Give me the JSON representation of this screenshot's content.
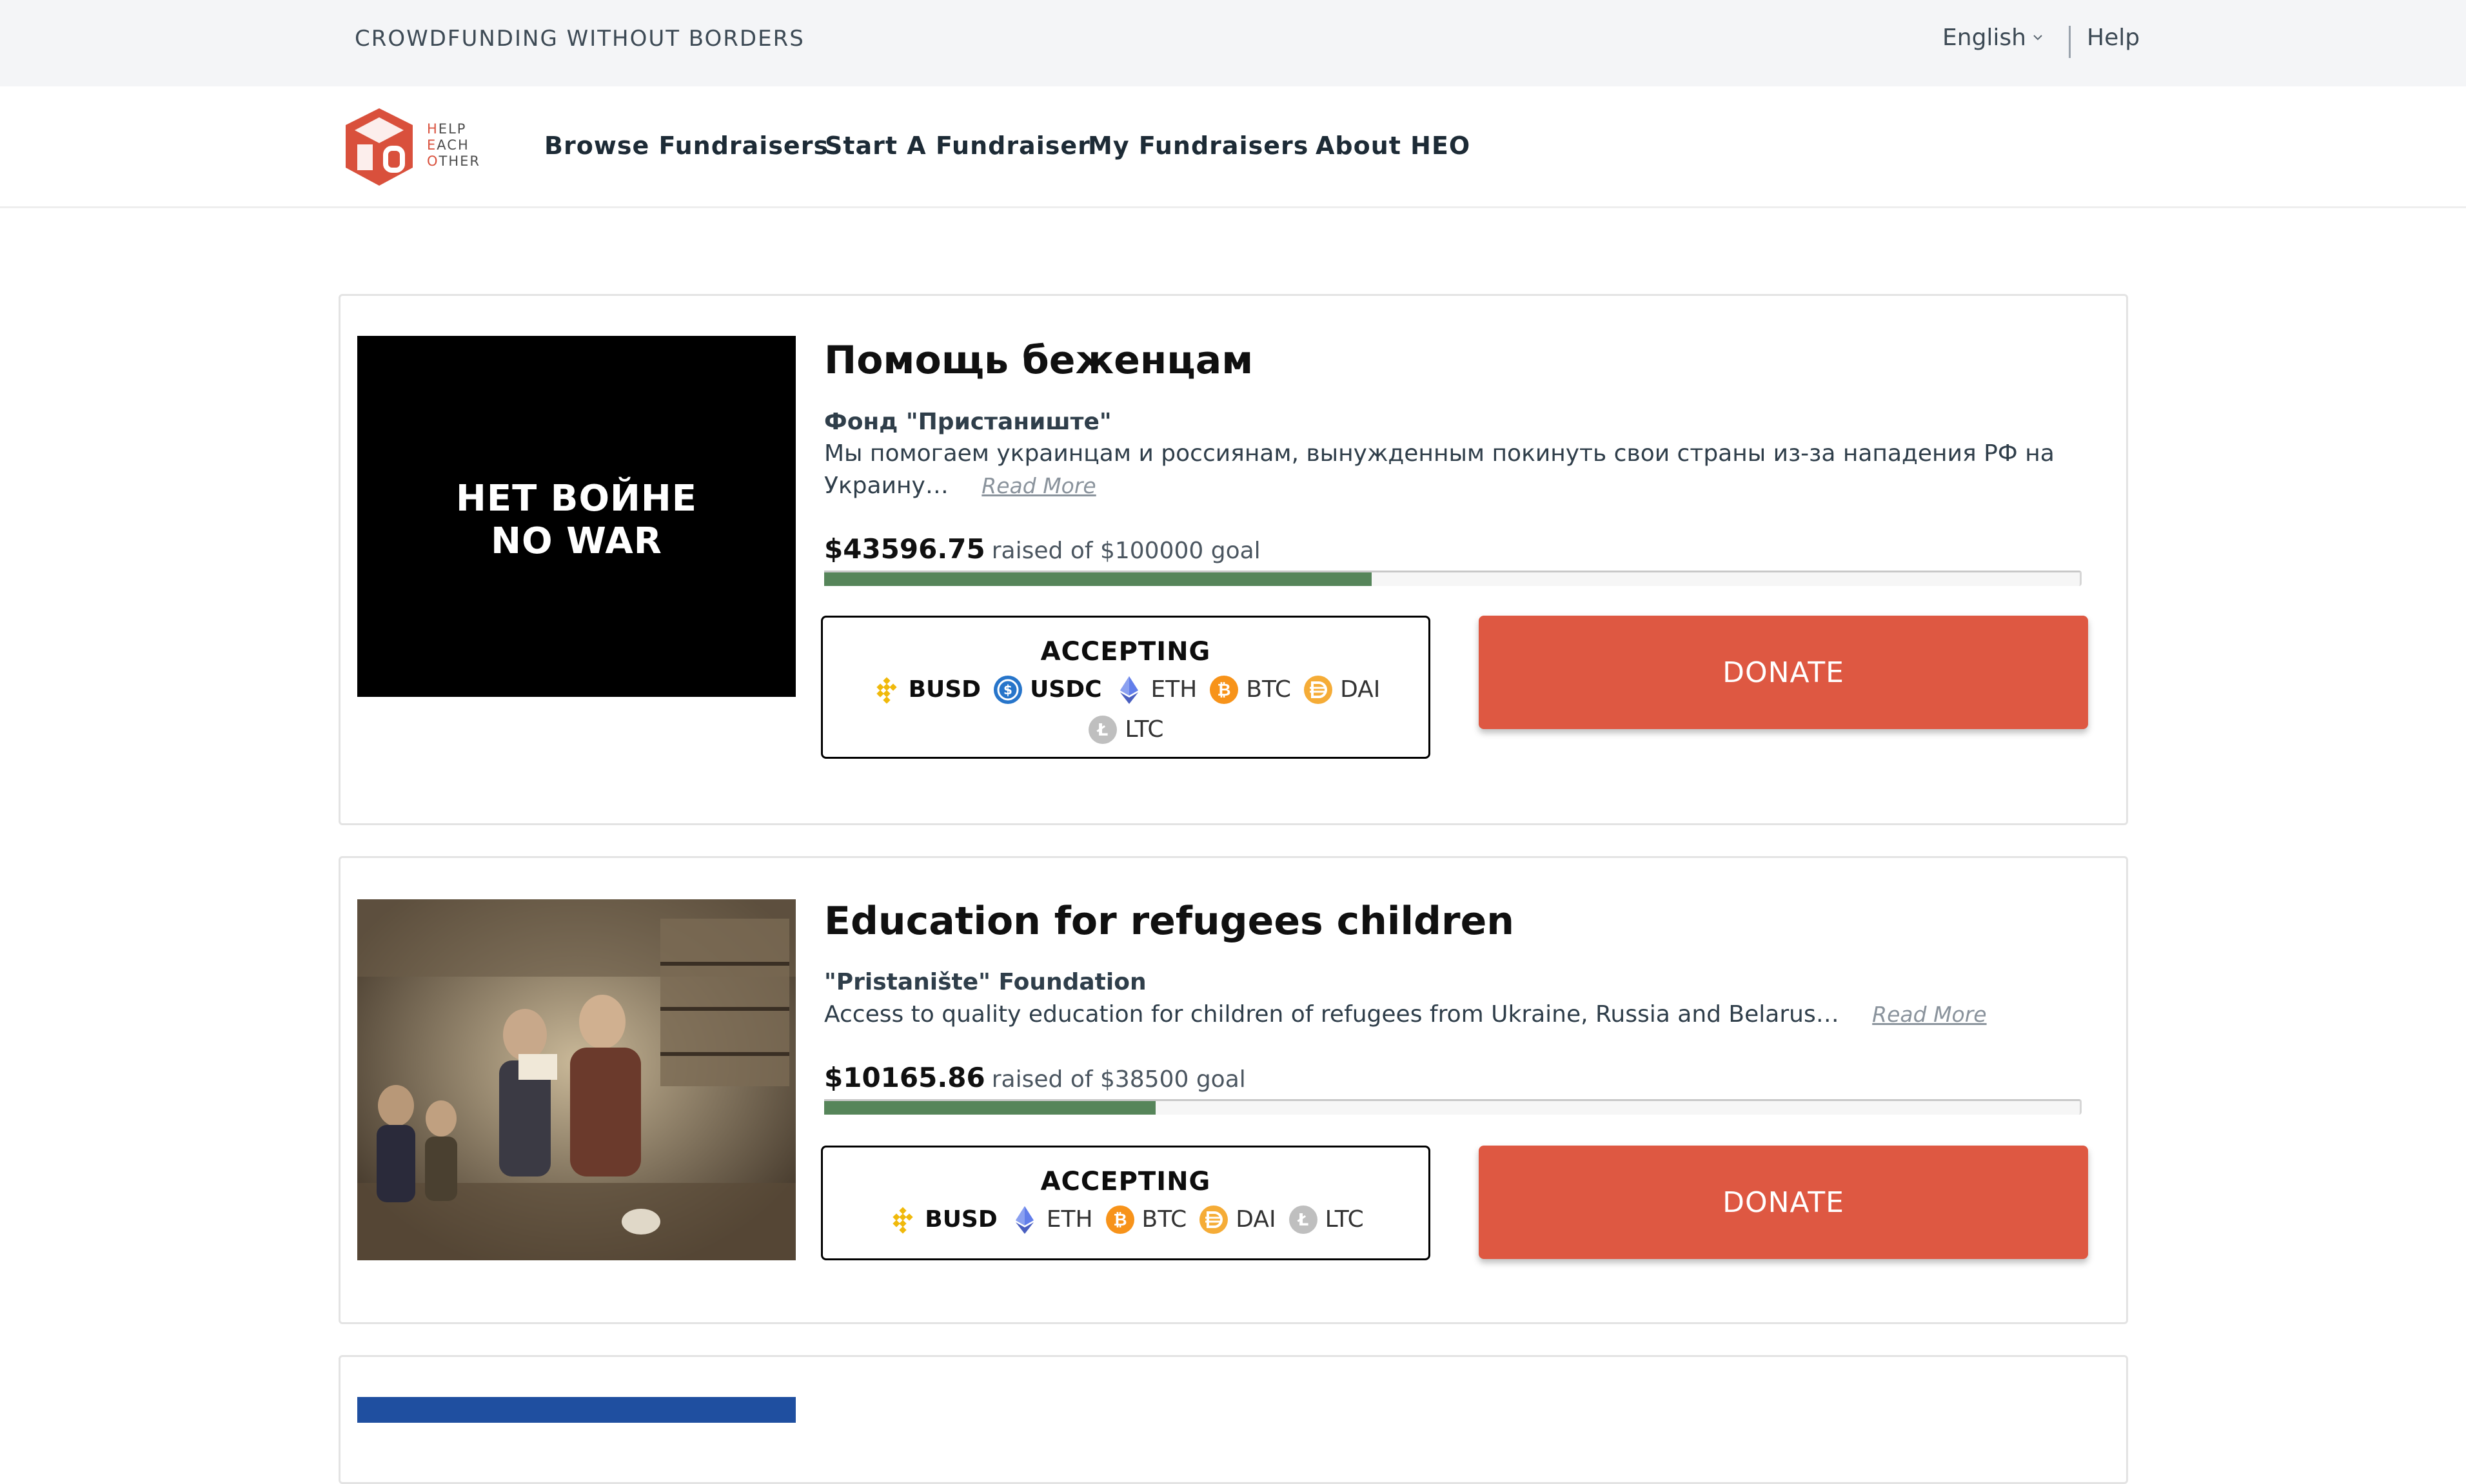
{
  "topbar": {
    "tagline": "CROWDFUNDING WITHOUT BORDERS",
    "language": "English",
    "help": "Help"
  },
  "logo": {
    "line1": "HELP",
    "line2": "EACH",
    "line3": "OTHER"
  },
  "nav": [
    {
      "label": "Browse Fundraisers"
    },
    {
      "label": "Start A Fundraiser"
    },
    {
      "label": "My Fundraisers"
    },
    {
      "label": "About HEO"
    }
  ],
  "fundraisers": [
    {
      "image_text_1": "НЕТ ВОЙНЕ",
      "image_text_2": "NO WAR",
      "title": "Помощь беженцам",
      "org": "Фонд \"Пристаниште\"",
      "description": "Мы помогаем украинцам и россиянам, вынужденным покинуть свои страны из-за нападения РФ на Украину…",
      "read_more": "Read More",
      "amount": "$43596.75",
      "goal_text": "raised of $100000 goal",
      "progress_fraction": 0.436,
      "accepting_label": "ACCEPTING",
      "coins": [
        {
          "name": "BUSD",
          "icon": "busd-icon"
        },
        {
          "name": "USDC",
          "icon": "usdc-icon"
        },
        {
          "name": "ETH",
          "icon": "eth-icon"
        },
        {
          "name": "BTC",
          "icon": "btc-icon"
        },
        {
          "name": "DAI",
          "icon": "dai-icon"
        },
        {
          "name": "LTC",
          "icon": "ltc-icon"
        }
      ],
      "donate_label": "DONATE"
    },
    {
      "title": "Education for refugees children",
      "org": "\"Pristanište\" Foundation",
      "description": "Access to quality education for children of refugees from Ukraine, Russia and Belarus…",
      "read_more": "Read More",
      "amount": "$10165.86",
      "goal_text": "raised of $38500 goal",
      "progress_fraction": 0.264,
      "accepting_label": "ACCEPTING",
      "coins": [
        {
          "name": "BUSD",
          "icon": "busd-icon"
        },
        {
          "name": "ETH",
          "icon": "eth-icon"
        },
        {
          "name": "BTC",
          "icon": "btc-icon"
        },
        {
          "name": "DAI",
          "icon": "dai-icon"
        },
        {
          "name": "LTC",
          "icon": "ltc-icon"
        }
      ],
      "donate_label": "DONATE"
    }
  ],
  "colors": {
    "brand_red": "#de5842",
    "progress_green": "#56855a",
    "topbar_bg": "#f4f5f7"
  }
}
